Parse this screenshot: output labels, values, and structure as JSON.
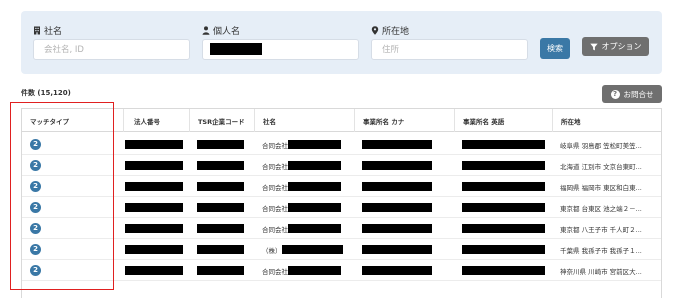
{
  "search": {
    "company_label": "社名",
    "company_placeholder": "会社名, ID",
    "person_label": "個人名",
    "location_label": "所在地",
    "location_placeholder": "住所",
    "search_button": "検索",
    "option_button": "オプション"
  },
  "results": {
    "count_text": "件数 (15,120)",
    "inquiry_button": "お問合せ"
  },
  "table": {
    "headers": [
      "マッチタイプ",
      "法人番号",
      "TSR企業コード",
      "社名",
      "事業所名 カナ",
      "事業所名 英語",
      "所在地"
    ],
    "rows": [
      {
        "match": "2",
        "name_prefix": "合同会社",
        "address": "岐阜県 羽島郡 笠松町美笠..."
      },
      {
        "match": "2",
        "name_prefix": "合同会社",
        "address": "北海道 江別市 文京台東町..."
      },
      {
        "match": "2",
        "name_prefix": "合同会社",
        "address": "福岡県 福岡市 東区和白東..."
      },
      {
        "match": "2",
        "name_prefix": "合同会社",
        "address": "東京都 台東区 池之端２－..."
      },
      {
        "match": "2",
        "name_prefix": "合同会社",
        "address": "東京都 八王子市 千人町２..."
      },
      {
        "match": "2",
        "name_prefix": "（株）",
        "address": "千葉県 我孫子市 我孫子１..."
      },
      {
        "match": "2",
        "name_prefix": "合同会社",
        "address": "神奈川県 川崎市 宮前区大..."
      }
    ]
  },
  "colors": {
    "panel_bg": "#e6eef7",
    "primary": "#3a78a6",
    "secondary_button": "#6f6f6f",
    "highlight": "#e02020"
  }
}
